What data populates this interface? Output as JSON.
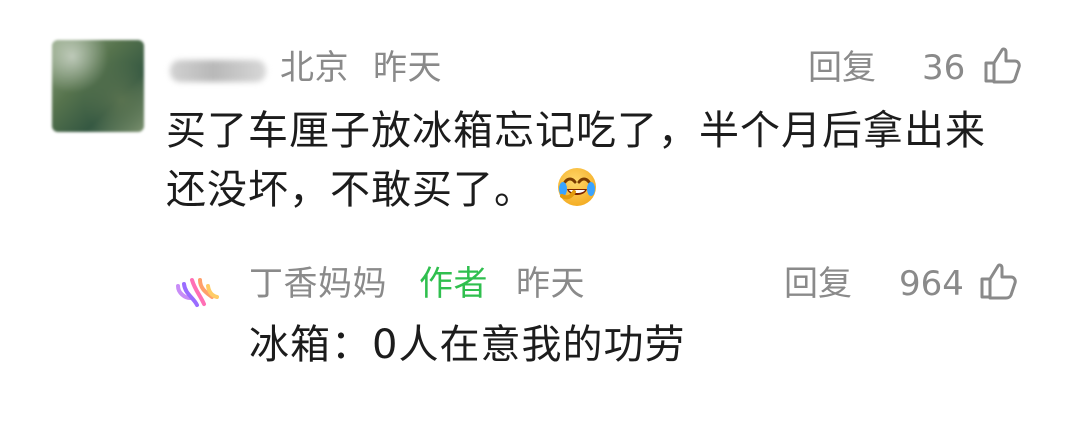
{
  "comment": {
    "user": {
      "name": "",
      "location": "北京",
      "time": "昨天"
    },
    "actions": {
      "reply_label": "回复",
      "like_count": "36"
    },
    "content": {
      "line1": "买了车厘子放冰箱忘记吃了，半个月后拿出来",
      "line2": "还没坏，不敢买了。"
    },
    "emoji_name": "laughing-crying-emoji-icon"
  },
  "reply": {
    "user": {
      "name": "丁香妈妈",
      "badge": "作者",
      "time": "昨天"
    },
    "actions": {
      "reply_label": "回复",
      "like_count": "964"
    },
    "content": "冰箱：0人在意我的功劳"
  },
  "colors": {
    "meta": "#8a8a8a",
    "text": "#1c1c1c",
    "author_badge": "#2fbf4e"
  }
}
